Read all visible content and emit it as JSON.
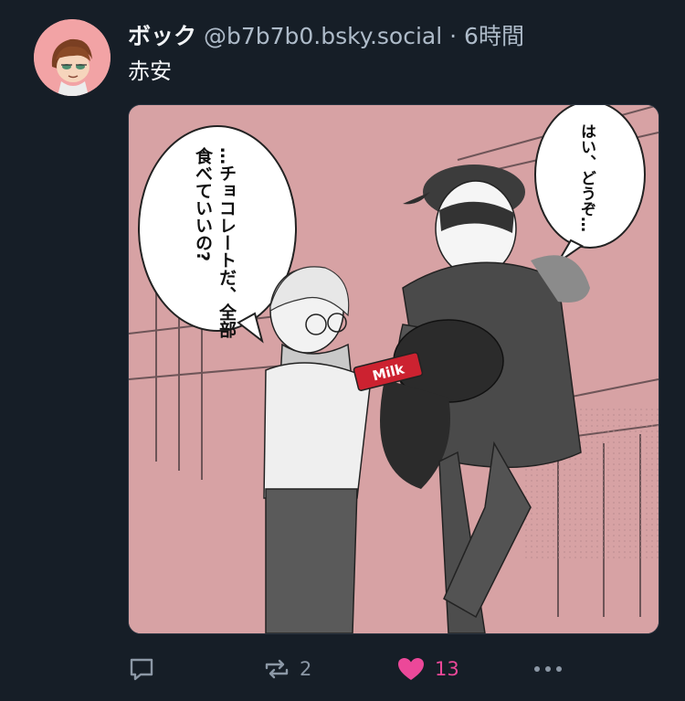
{
  "post": {
    "display_name": "ボック",
    "handle": "@b7b7b0.bsky.social",
    "separator": "·",
    "time": "6時間",
    "text": "赤安"
  },
  "image": {
    "speech_bubble_left": "…チョコレートだ、全部食べていいの?",
    "speech_bubble_right": "はい、どうぞ…",
    "package_text": "Milk"
  },
  "actions": {
    "reply_icon": "speech-bubble-icon",
    "repost_icon": "repost-arrows-icon",
    "repost_count": "2",
    "like_icon": "heart-icon",
    "like_count": "13",
    "like_color": "#ec4899",
    "more_icon": "ellipsis-icon"
  }
}
